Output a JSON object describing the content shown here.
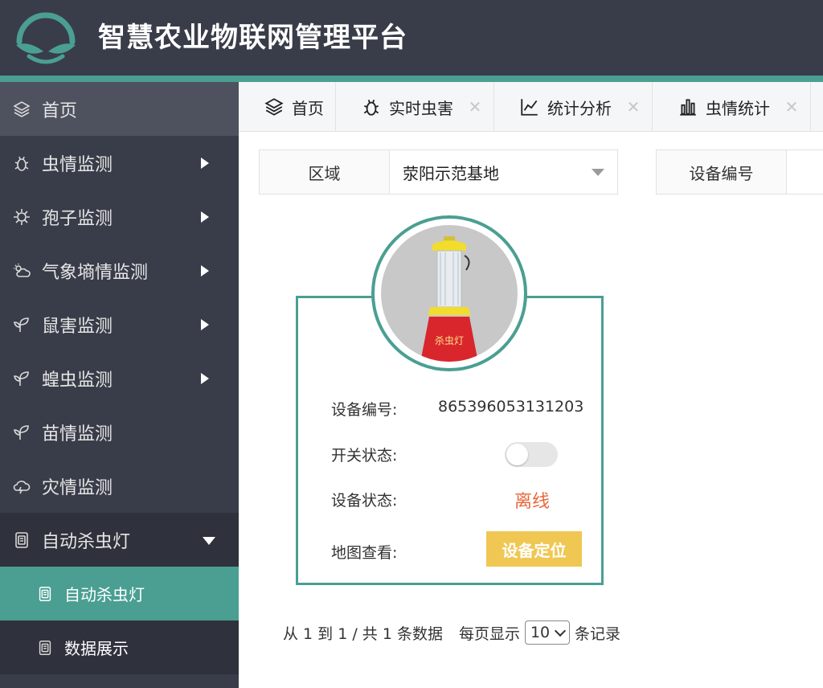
{
  "header": {
    "title": "智慧农业物联网管理平台"
  },
  "sidebar": {
    "items": [
      {
        "label": "首页",
        "icon": "layers-icon"
      },
      {
        "label": "虫情监测",
        "icon": "bug-icon"
      },
      {
        "label": "孢子监测",
        "icon": "spore-icon"
      },
      {
        "label": "气象墒情监测",
        "icon": "cloud-sun-icon"
      },
      {
        "label": "鼠害监测",
        "icon": "sprout-icon"
      },
      {
        "label": "蝗虫监测",
        "icon": "sprout-icon"
      },
      {
        "label": "苗情监测",
        "icon": "sprout-icon"
      },
      {
        "label": "灾情监测",
        "icon": "cloud-icon"
      },
      {
        "label": "自动杀虫灯",
        "icon": "lamp-icon"
      }
    ],
    "sub_items": [
      {
        "label": "自动杀虫灯",
        "icon": "lamp-icon"
      },
      {
        "label": "数据展示",
        "icon": "lamp-icon"
      }
    ]
  },
  "tabs": [
    {
      "label": "首页",
      "icon": "layers-icon"
    },
    {
      "label": "实时虫害",
      "icon": "bug-icon"
    },
    {
      "label": "统计分析",
      "icon": "line-chart-icon"
    },
    {
      "label": "虫情统计",
      "icon": "bar-chart-icon"
    }
  ],
  "filter": {
    "region_label": "区域",
    "region_value": "荥阳示范基地",
    "device_label": "设备编号"
  },
  "device_card": {
    "id_label": "设备编号:",
    "id_value": "865396053131203",
    "switch_label": "开关状态:",
    "switch_on": false,
    "status_label": "设备状态:",
    "status_value": "离线",
    "map_label": "地图查看:",
    "locate_button": "设备定位"
  },
  "pager": {
    "summary": "从 1 到 1 / 共 1 条数据",
    "per_page_label": "每页显示",
    "per_page_value": "10",
    "records_label": "条记录"
  },
  "colors": {
    "header_bg": "#393d49",
    "accent": "#4a9f92",
    "offline": "#e8683b",
    "button": "#f0c753"
  }
}
